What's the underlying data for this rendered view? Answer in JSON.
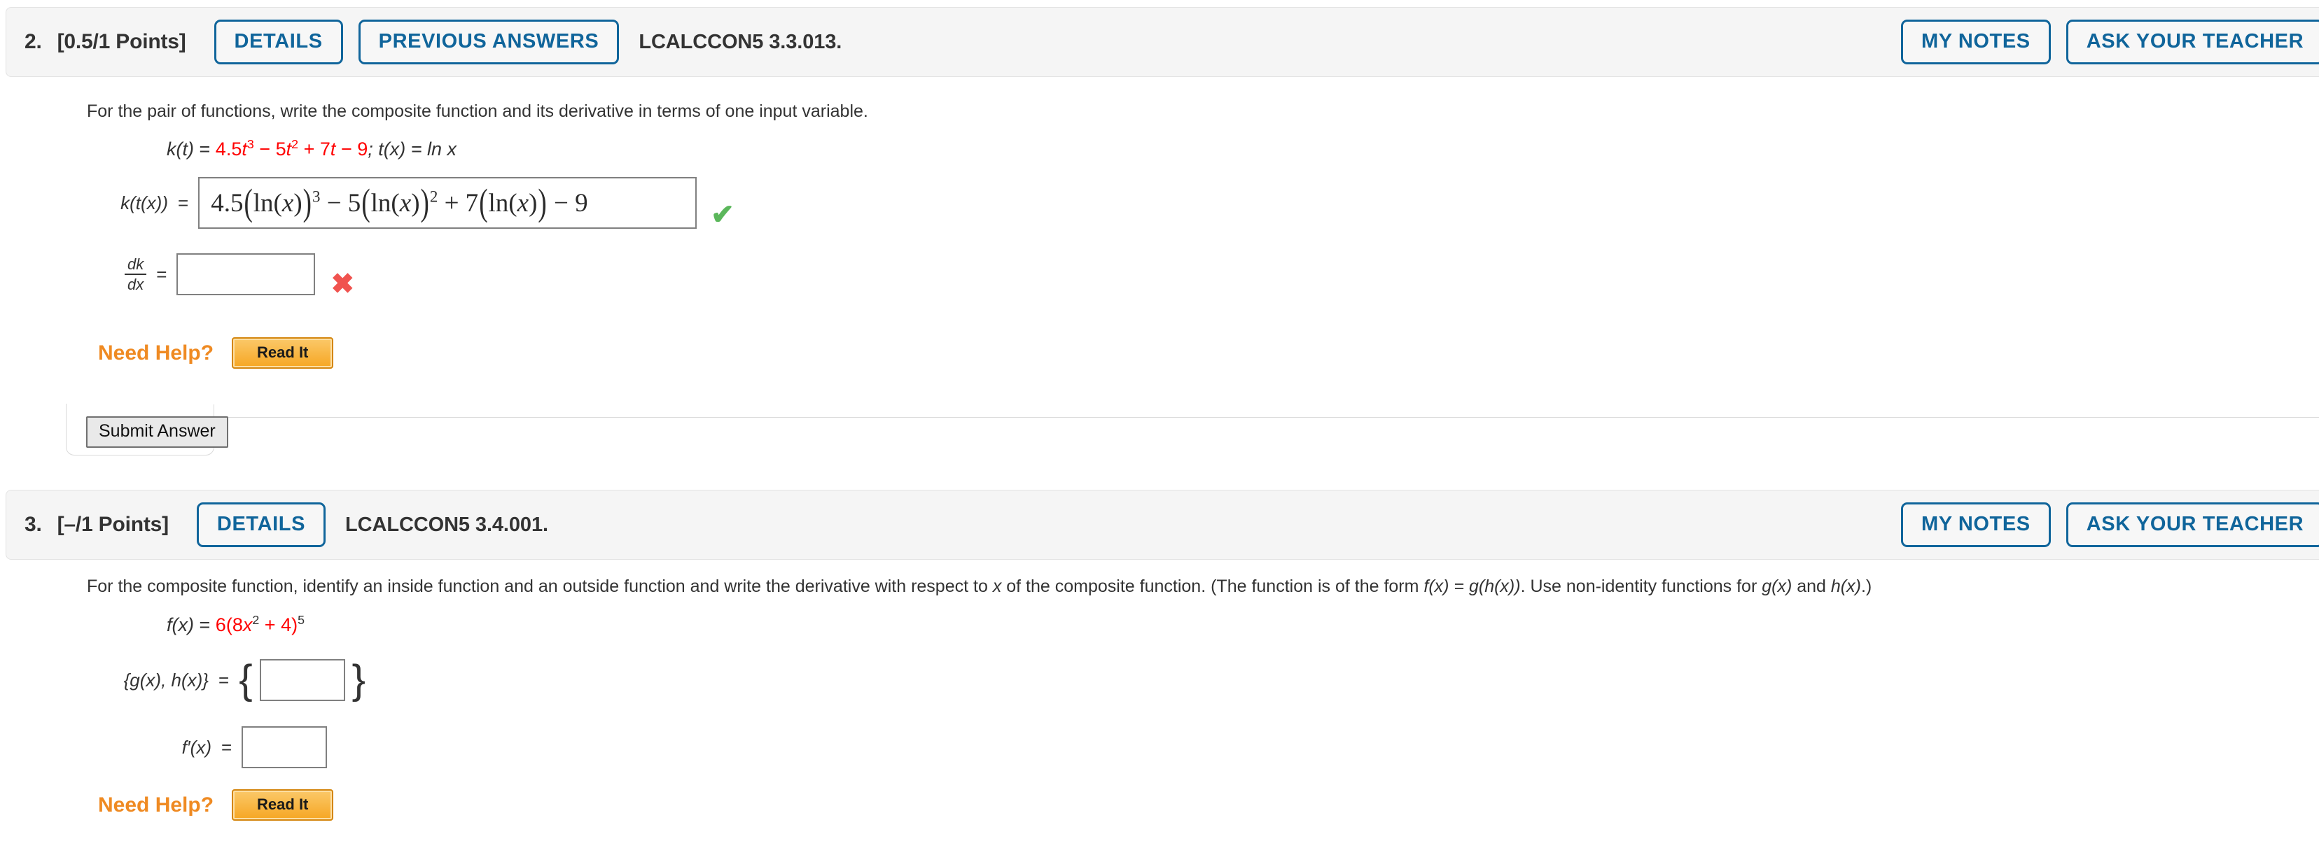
{
  "problems": [
    {
      "number": "2.",
      "points": "[0.5/1 Points]",
      "details_label": "DETAILS",
      "previous_answers_label": "PREVIOUS ANSWERS",
      "code": "LCALCCON5 3.3.013.",
      "my_notes_label": "MY NOTES",
      "ask_teacher_label": "ASK YOUR TEACHER",
      "prompt": "For the pair of functions, write the composite function and its derivative in terms of one input variable.",
      "given": {
        "lhs": "k(t)",
        "eq": "=",
        "term1_coef": "4.5",
        "term1_var": "t",
        "term1_exp": "3",
        "op1": "−",
        "term2_coef": "5",
        "term2_var": "t",
        "term2_exp": "2",
        "op2": "+",
        "term3_coef": "7",
        "term3_var": "t",
        "op3": "−",
        "term4_coef": "9",
        "second": "; t(x) = ln x"
      },
      "answer_rows": [
        {
          "label": "k(t(x))",
          "equals": "=",
          "value": "4.5(ln(x))³ − 5(ln(x))² + 7(ln(x)) − 9",
          "status": "correct",
          "status_icon": "check-icon"
        },
        {
          "label": "dk/dx",
          "label_num": "dk",
          "label_den": "dx",
          "equals": "=",
          "value": "",
          "status": "incorrect",
          "status_icon": "cross-icon"
        }
      ],
      "need_help_label": "Need Help?",
      "read_it_label": "Read It",
      "submit_label": "Submit Answer"
    },
    {
      "number": "3.",
      "points": "[–/1 Points]",
      "details_label": "DETAILS",
      "code": "LCALCCON5 3.4.001.",
      "my_notes_label": "MY NOTES",
      "ask_teacher_label": "ASK YOUR TEACHER",
      "prompt_part1": "For the composite function, identify an inside function and an outside function and write the derivative with respect to ",
      "prompt_x": "x",
      "prompt_part2": " of the composite function. (The function is of the form ",
      "prompt_form": "f(x) = g(h(x))",
      "prompt_part3": ". Use non-identity functions for ",
      "prompt_g": "g(x)",
      "prompt_and": " and ",
      "prompt_h": "h(x)",
      "prompt_end": ".)",
      "given": {
        "lhs": "f(x)",
        "eq": "=",
        "coef": "6",
        "open": "(",
        "inner_coef": "8",
        "inner_var": "x",
        "inner_exp": "2",
        "plus": "+",
        "inner_const": "4",
        "close": ")",
        "outer_exp": "5"
      },
      "answer_rows": [
        {
          "label": "{g(x), h(x)}",
          "equals": "=",
          "open_brace": "{",
          "close_brace": "}",
          "value": ""
        },
        {
          "label": "f′(x)",
          "equals": "=",
          "value": ""
        }
      ],
      "need_help_label": "Need Help?",
      "read_it_label": "Read It"
    }
  ],
  "colors": {
    "accent_blue": "#10659b",
    "header_bg": "#f5f5f5",
    "red": "#ff0000",
    "orange": "#ef8a22",
    "correct_green": "#5bb75b",
    "incorrect_red": "#f0534f",
    "text": "#333333"
  }
}
